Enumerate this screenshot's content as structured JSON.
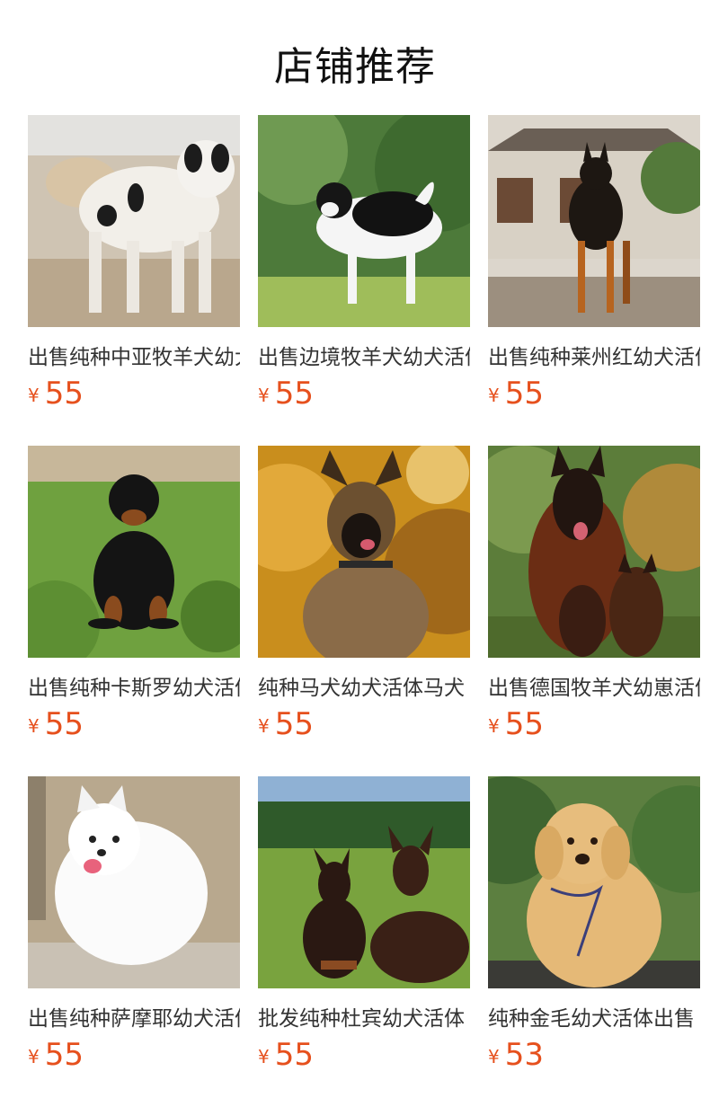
{
  "section": {
    "title": "店铺推荐"
  },
  "currency_symbol": "¥",
  "products": [
    {
      "name": "出售纯种中亚牧羊犬幼犬",
      "price": "55",
      "image": "white-black-spotted-shepherd-photo"
    },
    {
      "name": "出售边境牧羊犬幼犬活体",
      "price": "55",
      "image": "border-collie-photo"
    },
    {
      "name": "出售纯种莱州红幼犬活体",
      "price": "55",
      "image": "black-tan-doberman-photo"
    },
    {
      "name": "出售纯种卡斯罗幼犬活体",
      "price": "55",
      "image": "rottweiler-puppy-photo"
    },
    {
      "name": "纯种马犬幼犬活体马犬",
      "price": "55",
      "image": "malinois-photo"
    },
    {
      "name": "出售德国牧羊犬幼崽活体",
      "price": "55",
      "image": "german-shepherd-family-photo"
    },
    {
      "name": "出售纯种萨摩耶幼犬活体",
      "price": "55",
      "image": "samoyed-photo"
    },
    {
      "name": "批发纯种杜宾幼犬活体",
      "price": "55",
      "image": "two-dobermans-photo"
    },
    {
      "name": "纯种金毛幼犬活体出售",
      "price": "53",
      "image": "golden-retriever-puppy-photo"
    }
  ]
}
